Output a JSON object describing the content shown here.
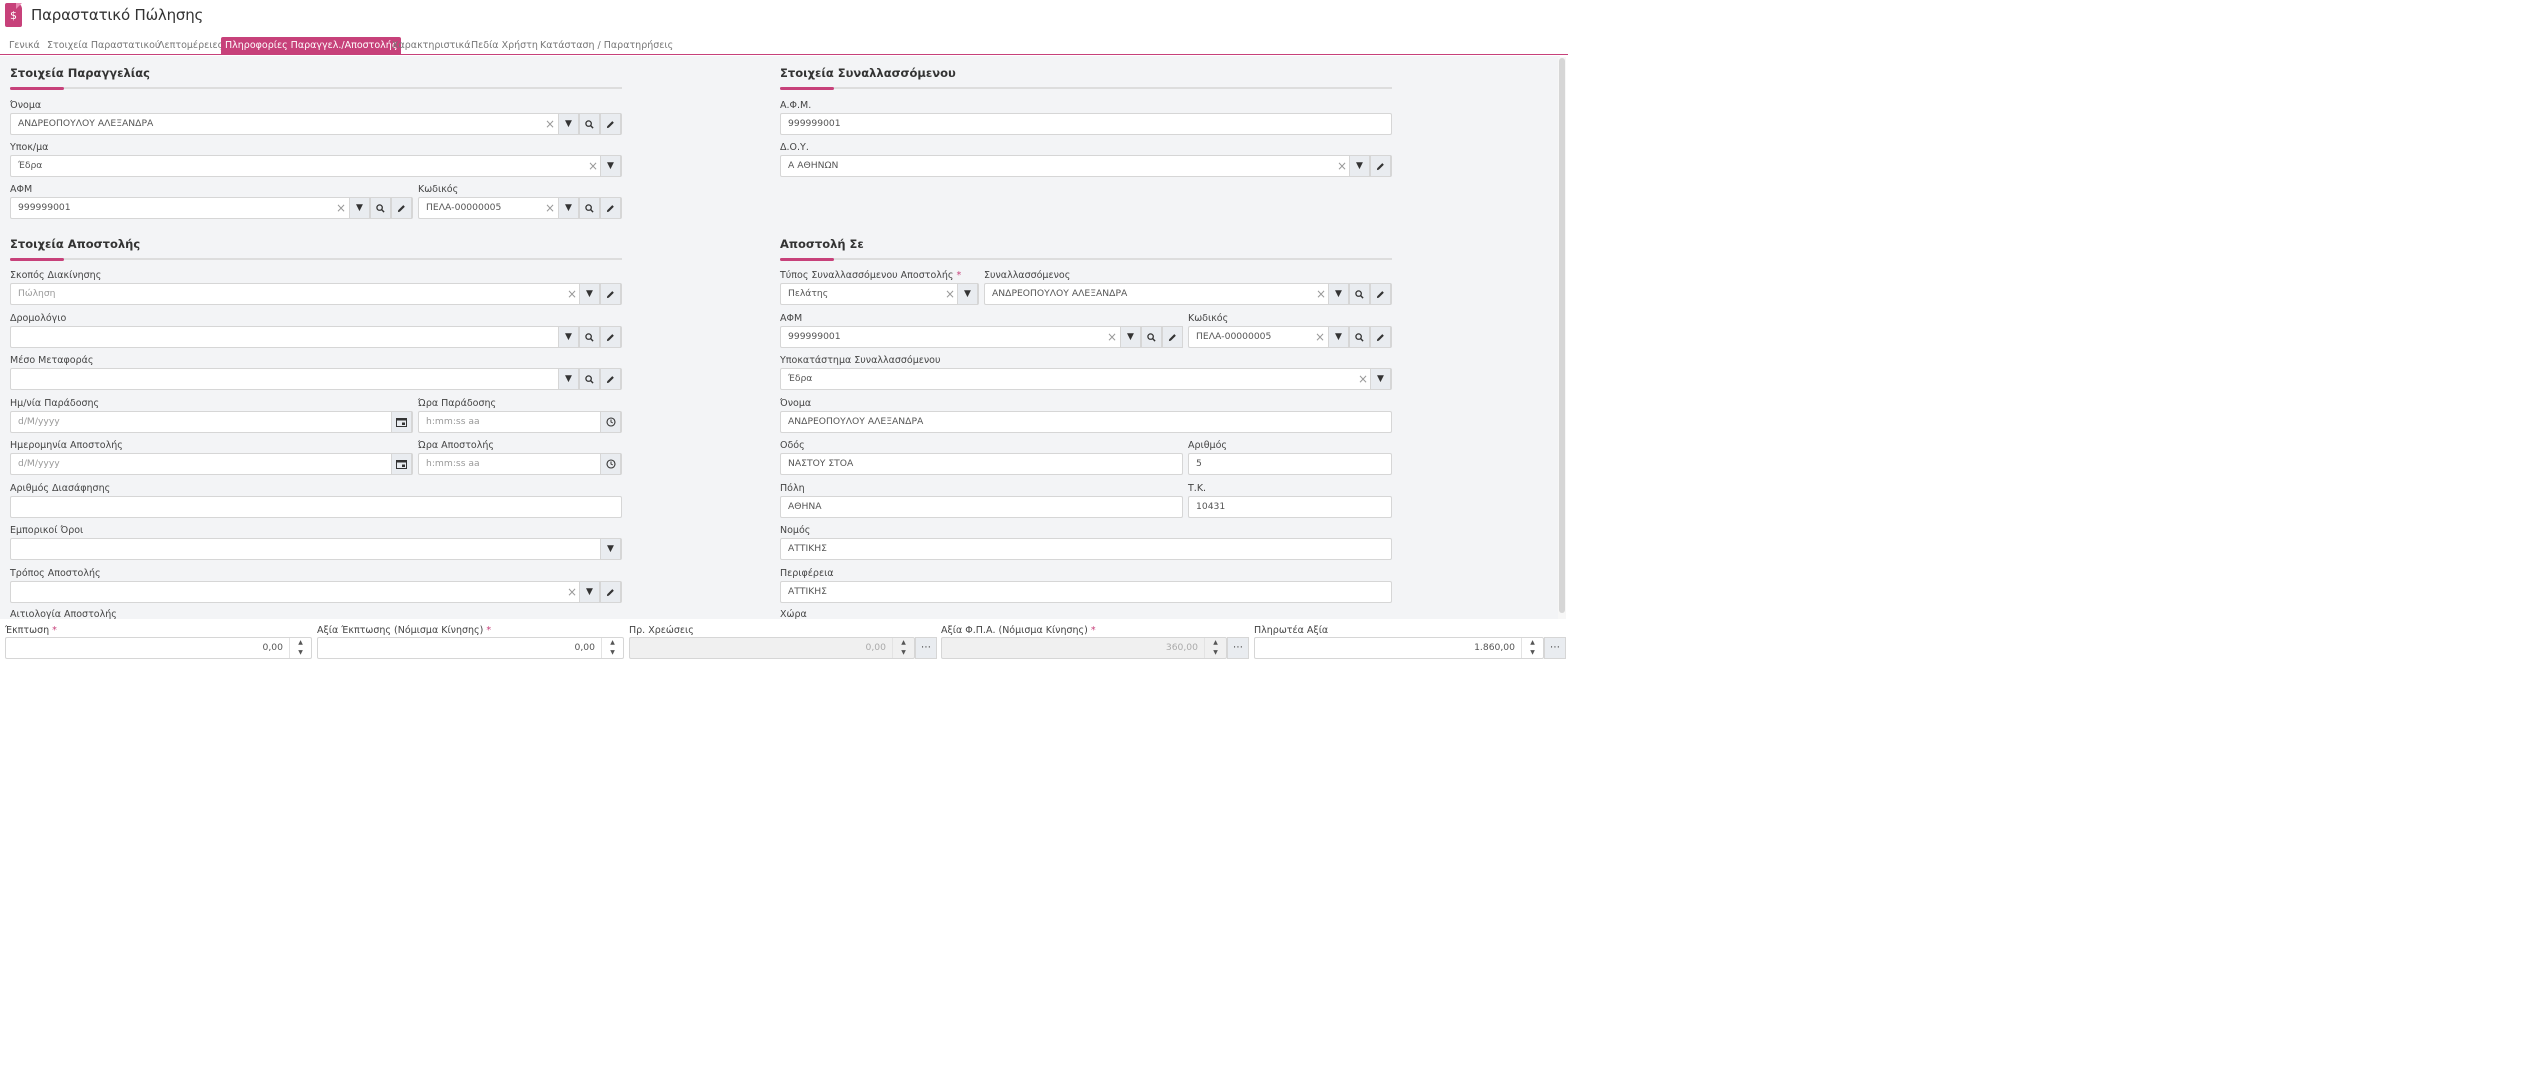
{
  "header": {
    "title": "Παραστατικό Πώλησης",
    "icon": "invoice-dollar-icon"
  },
  "tabs": [
    {
      "label": "Γενικά"
    },
    {
      "label": "Στοιχεία Παραστατικού"
    },
    {
      "label": "Λεπτομέρειες"
    },
    {
      "label": "Πληροφορίες Παραγγελ./Αποστολής"
    },
    {
      "label": "Χαρακτηριστικά"
    },
    {
      "label": "Πεδία Χρήστη"
    },
    {
      "label": "Κατάσταση / Παρατηρήσεις"
    }
  ],
  "order": {
    "title": "Στοιχεία Παραγγελίας",
    "name_label": "Όνομα",
    "name_value": "ΑΝΔΡΕΟΠΟΥΛΟΥ ΑΛΕΞΑΝΔΡΑ",
    "branch_label": "Υποκ/μα",
    "branch_value": "Έδρα",
    "afm_label": "ΑΦΜ",
    "afm_value": "999999001",
    "code_label": "Κωδικός",
    "code_value": "ΠΕΛΑ-00000005"
  },
  "trader": {
    "title": "Στοιχεία Συναλλασσόμενου",
    "afm_label": "Α.Φ.Μ.",
    "afm_value": "999999001",
    "doy_label": "Δ.Ο.Υ.",
    "doy_value": "Α ΑΘΗΝΩΝ"
  },
  "shipping": {
    "title": "Στοιχεία Αποστολής",
    "purpose_label": "Σκοπός Διακίνησης",
    "purpose_value": "Πώληση",
    "route_label": "Δρομολόγιο",
    "route_value": "",
    "transport_label": "Μέσο Μεταφοράς",
    "transport_value": "",
    "delivery_date_label": "Ημ/νία Παράδοσης",
    "delivery_date_placeholder": "d/M/yyyy",
    "delivery_time_label": "Ώρα Παράδοσης",
    "delivery_time_placeholder": "h:mm:ss aa",
    "ship_date_label": "Ημερομηνία Αποστολής",
    "ship_date_placeholder": "d/M/yyyy",
    "ship_time_label": "Ώρα Αποστολής",
    "ship_time_placeholder": "h:mm:ss aa",
    "clearance_label": "Αριθμός Διασάφησης",
    "clearance_value": "",
    "terms_label": "Εμπορικοί Όροι",
    "terms_value": "",
    "method_label": "Τρόπος Αποστολής",
    "method_value": "",
    "reason_label": "Αιτιολογία Αποστολής"
  },
  "shipto": {
    "title": "Αποστολή Σε",
    "type_label": "Τύπος Συναλλασσόμενου Αποστολής",
    "type_value": "Πελάτης",
    "trader_label": "Συναλλασσόμενος",
    "trader_value": "ΑΝΔΡΕΟΠΟΥΛΟΥ ΑΛΕΞΑΝΔΡΑ",
    "afm_label": "ΑΦΜ",
    "afm_value": "999999001",
    "code_label": "Κωδικός",
    "code_value": "ΠΕΛΑ-00000005",
    "branch_label": "Υποκατάστημα Συναλλασσόμενου",
    "branch_value": "Έδρα",
    "name_label": "Όνομα",
    "name_value": "ΑΝΔΡΕΟΠΟΥΛΟΥ ΑΛΕΞΑΝΔΡΑ",
    "street_label": "Οδός",
    "street_value": "ΝΑΣΤΟΥ ΣΤΟΑ",
    "number_label": "Αριθμός",
    "number_value": "5",
    "city_label": "Πόλη",
    "city_value": "ΑΘΗΝΑ",
    "zip_label": "Τ.Κ.",
    "zip_value": "10431",
    "prefecture_label": "Νομός",
    "prefecture_value": "ΑΤΤΙΚΗΣ",
    "region_label": "Περιφέρεια",
    "region_value": "ΑΤΤΙΚΗΣ",
    "country_label": "Χώρα"
  },
  "footer": {
    "discount_label": "Έκπτωση",
    "discount_value": "0,00",
    "discount_amount_label": "Αξία Έκπτωσης (Νόμισμα Κίνησης)",
    "discount_amount_value": "0,00",
    "charges_label": "Πρ. Χρεώσεις",
    "charges_value": "0,00",
    "vat_label": "Αξία Φ.Π.Α. (Νόμισμα Κίνησης)",
    "vat_value": "360,00",
    "payable_label": "Πληρωτέα Αξία",
    "payable_value": "1.860,00",
    "required_mark": "*"
  },
  "colors": {
    "accent": "#c7417a",
    "panel": "#f3f4f6"
  }
}
